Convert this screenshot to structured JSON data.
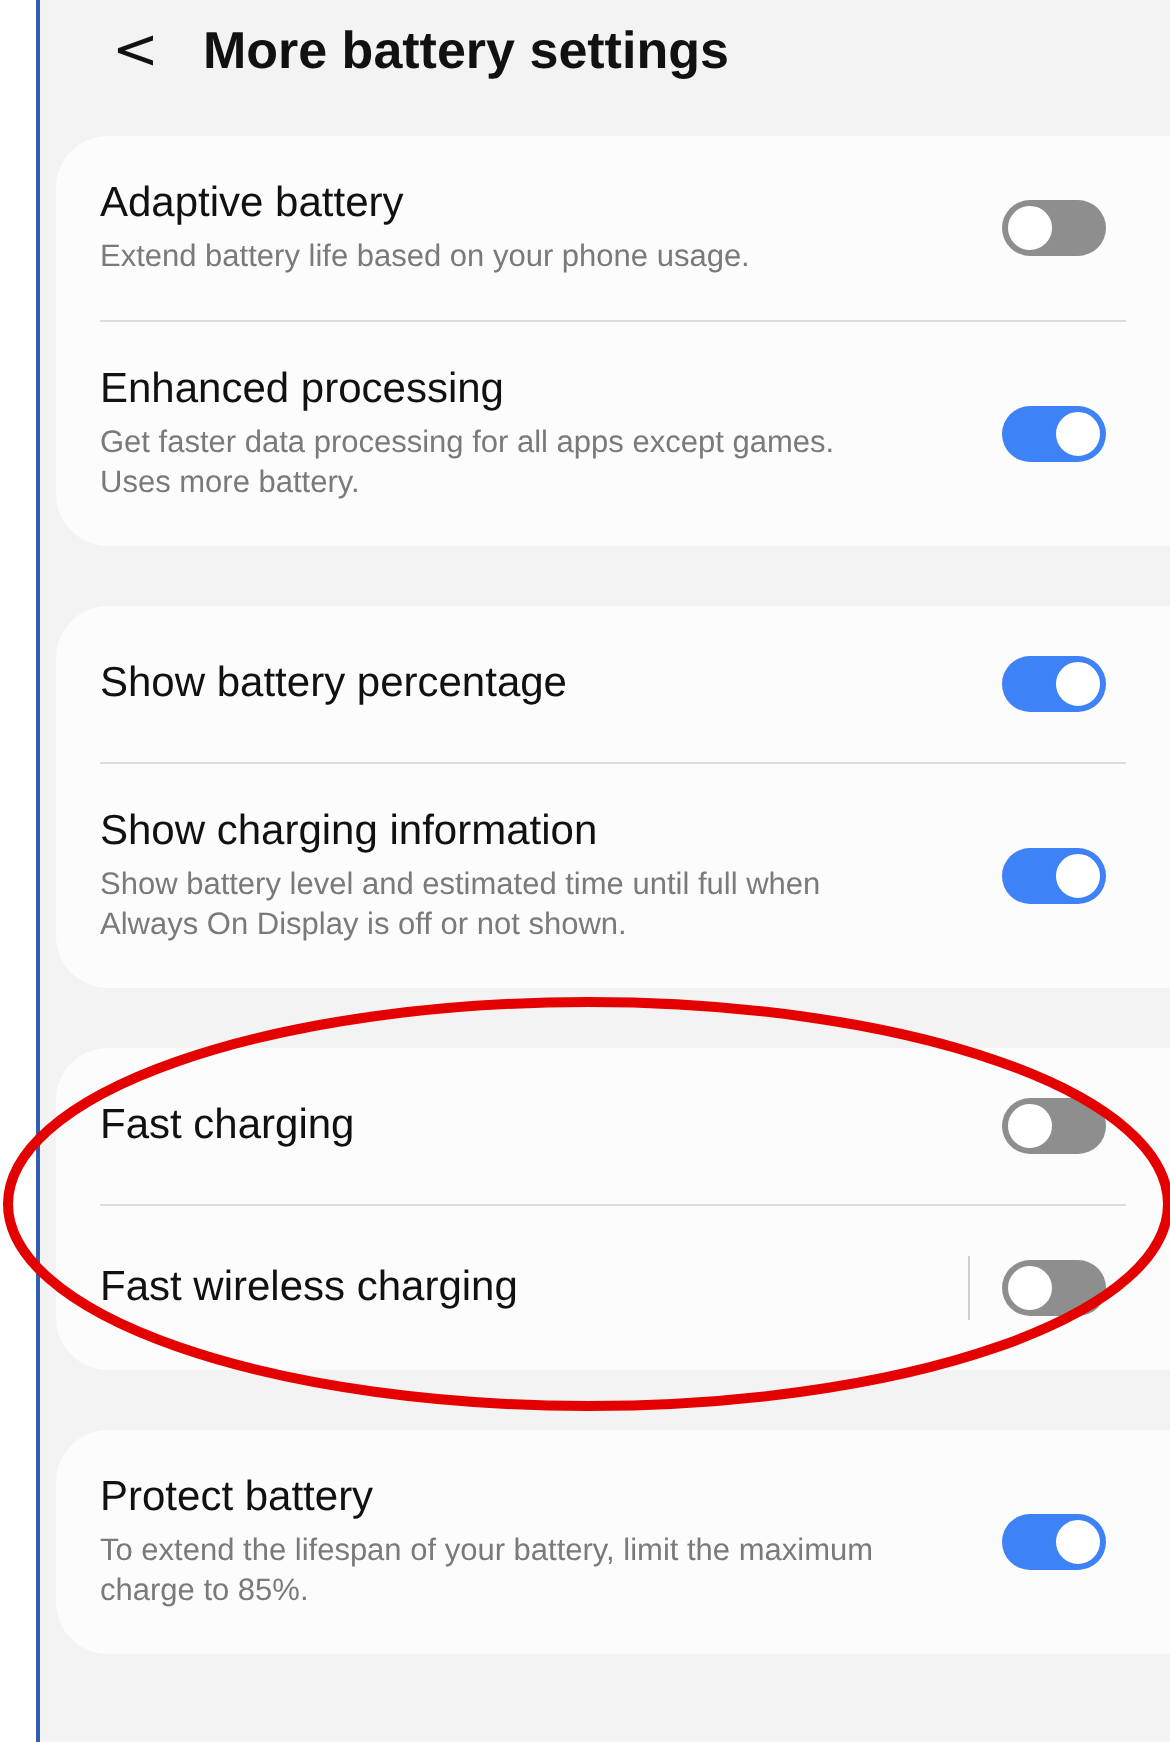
{
  "header": {
    "back": "<",
    "title": "More battery settings"
  },
  "groups": [
    {
      "items": [
        {
          "title": "Adaptive battery",
          "subtitle": "Extend battery life based on your phone usage.",
          "on": false,
          "separator": false
        },
        {
          "title": "Enhanced processing",
          "subtitle": "Get faster data processing for all apps except games. Uses more battery.",
          "on": true,
          "separator": false
        }
      ]
    },
    {
      "items": [
        {
          "title": "Show battery percentage",
          "on": true,
          "separator": false
        },
        {
          "title": "Show charging information",
          "subtitle": "Show battery level and estimated time until full when Always On Display is off or not shown.",
          "on": true,
          "separator": false
        }
      ]
    },
    {
      "items": [
        {
          "title": "Fast charging",
          "on": false,
          "separator": false
        },
        {
          "title": "Fast wireless charging",
          "on": false,
          "separator": true
        }
      ]
    },
    {
      "items": [
        {
          "title": "Protect battery",
          "subtitle": "To extend the lifespan of your battery, limit the maximum charge to 85%.",
          "on": true,
          "separator": false
        }
      ]
    }
  ]
}
